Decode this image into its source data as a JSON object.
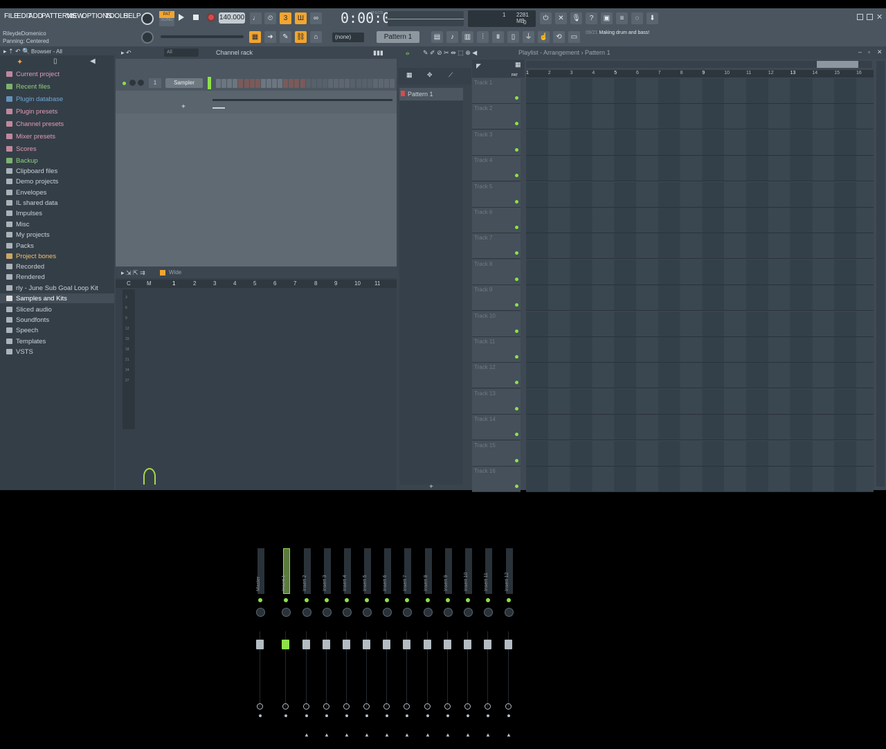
{
  "menu": [
    "FILE",
    "EDIT",
    "ADD",
    "PATTERNS",
    "VIEW",
    "OPTIONS",
    "TOOLS",
    "HELP"
  ],
  "transport": {
    "pat_label": "PAT",
    "song_label": "SONG",
    "tempo": "140.000",
    "time": "0:00:00",
    "time_unit": "M:S:CS"
  },
  "status": {
    "user": "RileydeDomenico",
    "hint": "Panning: Centered"
  },
  "memory": {
    "cpu": "1",
    "ram": "2281 MB",
    "poly": "0"
  },
  "pattern_selector": {
    "none": "(none)",
    "pattern": "Pattern 1"
  },
  "news": {
    "date": "09/21",
    "text": "Making drum and bass!"
  },
  "browser": {
    "header": "Browser - All",
    "items": [
      {
        "label": "Current project",
        "color": "#e29bb4",
        "icon": "project-icon"
      },
      {
        "label": "Recent files",
        "color": "#8fd07a",
        "icon": "folder-icon"
      },
      {
        "label": "Plugin database",
        "color": "#6ea9d8",
        "icon": "plugin-icon"
      },
      {
        "label": "Plugin presets",
        "color": "#e29bb4",
        "icon": "plugin-icon"
      },
      {
        "label": "Channel presets",
        "color": "#e29bb4",
        "icon": "folder-icon"
      },
      {
        "label": "Mixer presets",
        "color": "#e29bb4",
        "icon": "mixer-icon"
      },
      {
        "label": "Scores",
        "color": "#e29bb4",
        "icon": "note-icon"
      },
      {
        "label": "Backup",
        "color": "#8fd07a",
        "icon": "folder-icon"
      },
      {
        "label": "Clipboard files",
        "color": "#c9d1d6",
        "icon": "folder-icon"
      },
      {
        "label": "Demo projects",
        "color": "#c9d1d6",
        "icon": "folder-icon"
      },
      {
        "label": "Envelopes",
        "color": "#c9d1d6",
        "icon": "folder-icon"
      },
      {
        "label": "IL shared data",
        "color": "#c9d1d6",
        "icon": "folder-icon"
      },
      {
        "label": "Impulses",
        "color": "#c9d1d6",
        "icon": "folder-icon"
      },
      {
        "label": "Misc",
        "color": "#c9d1d6",
        "icon": "folder-icon"
      },
      {
        "label": "My projects",
        "color": "#c9d1d6",
        "icon": "folder-icon"
      },
      {
        "label": "Packs",
        "color": "#c9d1d6",
        "icon": "pack-icon"
      },
      {
        "label": "Project bones",
        "color": "#f0c070",
        "icon": "folder-icon"
      },
      {
        "label": "Recorded",
        "color": "#c9d1d6",
        "icon": "plus-icon"
      },
      {
        "label": "Rendered",
        "color": "#c9d1d6",
        "icon": "plus-icon"
      },
      {
        "label": "rly - June Sub Goal Loop Kit",
        "color": "#c9d1d6",
        "icon": "folder-icon"
      },
      {
        "label": "Samples and Kits",
        "color": "#ffffff",
        "icon": "folder-icon"
      },
      {
        "label": "Sliced audio",
        "color": "#c9d1d6",
        "icon": "plus-icon"
      },
      {
        "label": "Soundfonts",
        "color": "#c9d1d6",
        "icon": "plus-icon"
      },
      {
        "label": "Speech",
        "color": "#c9d1d6",
        "icon": "plus-icon"
      },
      {
        "label": "Templates",
        "color": "#c9d1d6",
        "icon": "plus-icon"
      },
      {
        "label": "VSTS",
        "color": "#c9d1d6",
        "icon": "plus-icon"
      }
    ]
  },
  "channel_rack": {
    "title": "Channel rack",
    "filter": "All",
    "channel_number": "1",
    "channel_name": "Sampler"
  },
  "mixer": {
    "view": "Wide",
    "header_labels": [
      "C",
      "M",
      "1",
      "2",
      "3",
      "4",
      "5",
      "6",
      "7",
      "8",
      "9",
      "10",
      "11"
    ],
    "scale": [
      "3",
      "6",
      "9",
      "12",
      "15",
      "18",
      "21",
      "24",
      "27"
    ],
    "strips": [
      "Master",
      "Insert 1",
      "Insert 2",
      "Insert 3",
      "Insert 4",
      "Insert 5",
      "Insert 6",
      "Insert 7",
      "Insert 8",
      "Insert 9",
      "Insert 10",
      "Insert 11",
      "Insert 12"
    ]
  },
  "picker": {
    "pattern": "Pattern 1"
  },
  "playlist": {
    "title": "Playlist - Arrangement",
    "pattern": "Pattern 1",
    "pat_tag": "PAT",
    "ruler": [
      "1",
      "2",
      "3",
      "4",
      "5",
      "6",
      "7",
      "8",
      "9",
      "10",
      "11",
      "12",
      "13",
      "14",
      "15",
      "16"
    ],
    "tracks": [
      "Track 1",
      "Track 2",
      "Track 3",
      "Track 4",
      "Track 5",
      "Track 6",
      "Track 7",
      "Track 8",
      "Track 9",
      "Track 10",
      "Track 11",
      "Track 12",
      "Track 13",
      "Track 14",
      "Track 15",
      "Track 16"
    ]
  },
  "colors": {
    "accent": "#f2a530",
    "green": "#8ee04a",
    "panel": "#3c4650"
  }
}
